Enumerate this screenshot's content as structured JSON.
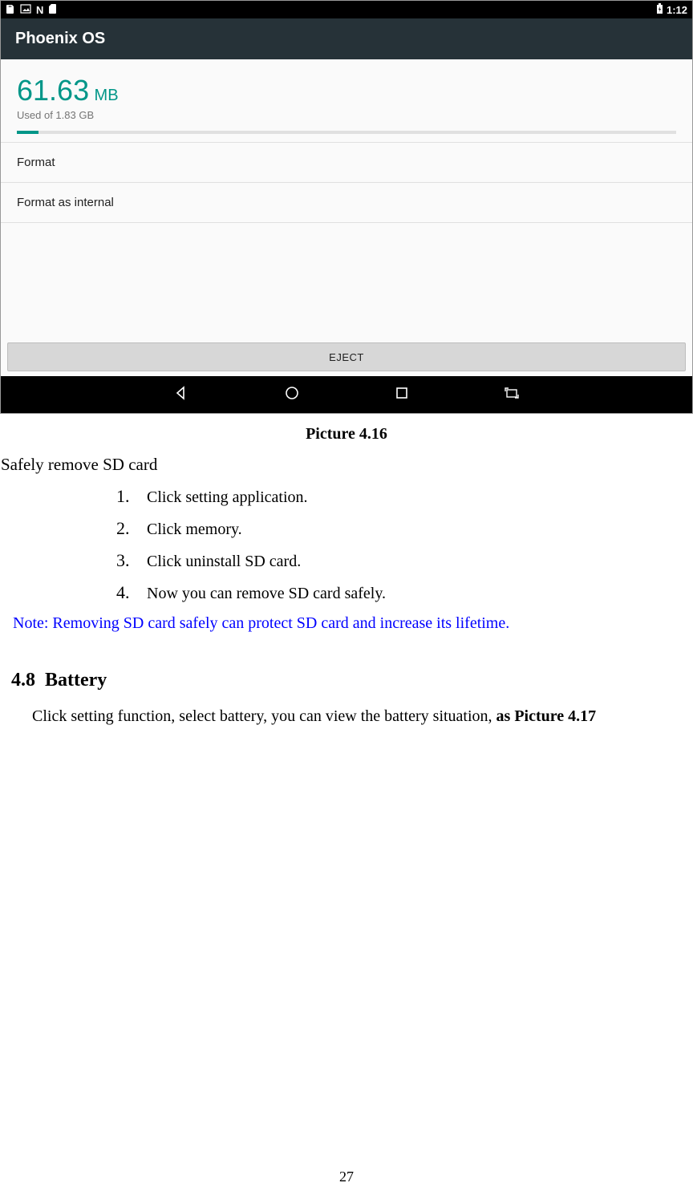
{
  "screenshot": {
    "status_time": "1:12",
    "app_title": "Phoenix OS",
    "storage": {
      "value": "61.63",
      "unit": "MB",
      "subtext": "Used of 1.83 GB"
    },
    "menu": {
      "format": "Format",
      "format_internal": "Format as internal"
    },
    "eject_label": "EJECT"
  },
  "doc": {
    "caption": "Picture 4.16",
    "sd_heading": "Safely remove SD card",
    "steps": [
      "Click setting application.",
      "Click memory.",
      "Click uninstall SD card.",
      "Now you can remove SD card safely."
    ],
    "note": "Note: Removing SD card safely can protect SD card and increase its lifetime.",
    "section_num": "4.8",
    "section_title": "Battery",
    "body_prefix": "Click setting function, select battery, you can view the battery situation, ",
    "body_bold": "as Picture 4.17",
    "page_number": "27"
  }
}
